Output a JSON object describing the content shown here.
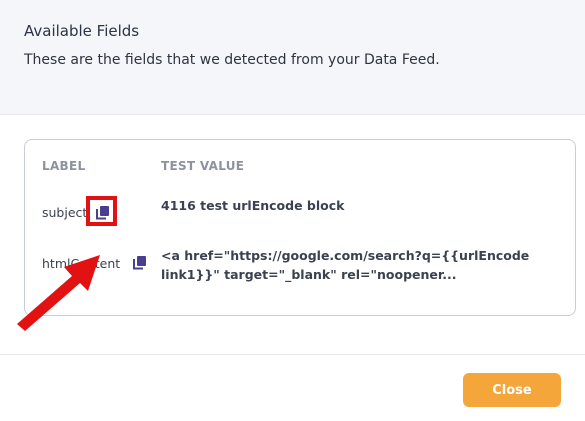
{
  "header": {
    "title": "Available Fields",
    "subtitle": "These are the fields that we detected from your Data Feed."
  },
  "table": {
    "columns": [
      "LABEL",
      "TEST VALUE"
    ],
    "rows": [
      {
        "label": "subject",
        "value": "4116 test urlEncode block"
      },
      {
        "label": "htmlContent",
        "value": "<a href=\"https://google.com/search?q={{urlEncode link1}}\" target=\"_blank\" rel=\"noopener..."
      }
    ]
  },
  "icons": {
    "copy": "copy-icon"
  },
  "annotation": {
    "highlight_color": "#e21212",
    "arrow_color": "#e21212"
  },
  "footer": {
    "close_label": "Close"
  },
  "colors": {
    "accent": "#f5a63a",
    "icon": "#4a3f8c"
  }
}
